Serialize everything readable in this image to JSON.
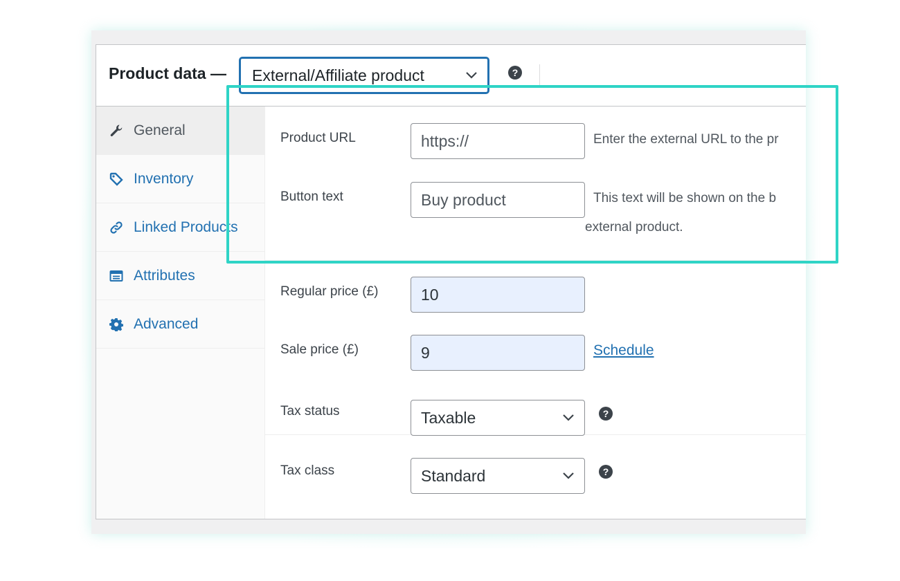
{
  "header": {
    "title": "Product data —",
    "product_type": "External/Affiliate product",
    "help_glyph": "?"
  },
  "sidebar": {
    "items": [
      {
        "label": "General",
        "icon": "wrench-icon",
        "active": true
      },
      {
        "label": "Inventory",
        "icon": "tag-icon",
        "active": false
      },
      {
        "label": "Linked Products",
        "icon": "link-icon",
        "active": false
      },
      {
        "label": "Attributes",
        "icon": "table-icon",
        "active": false
      },
      {
        "label": "Advanced",
        "icon": "gear-icon",
        "active": false
      }
    ]
  },
  "external": {
    "product_url_label": "Product URL",
    "product_url_value": "https://",
    "product_url_desc": "Enter the external URL to the pr",
    "button_text_label": "Button text",
    "button_text_value": "Buy product",
    "button_text_desc_line1": "This text will be shown on the b",
    "button_text_desc_line2": "external product."
  },
  "pricing": {
    "regular_price_label": "Regular price (£)",
    "regular_price_value": "10",
    "sale_price_label": "Sale price (£)",
    "sale_price_value": "9",
    "schedule_link": "Schedule"
  },
  "tax": {
    "tax_status_label": "Tax status",
    "tax_status_value": "Taxable",
    "tax_class_label": "Tax class",
    "tax_class_value": "Standard"
  },
  "colors": {
    "accent": "#2271b1",
    "highlight": "#2fd4c6",
    "autofill": "#e8f0fe"
  }
}
